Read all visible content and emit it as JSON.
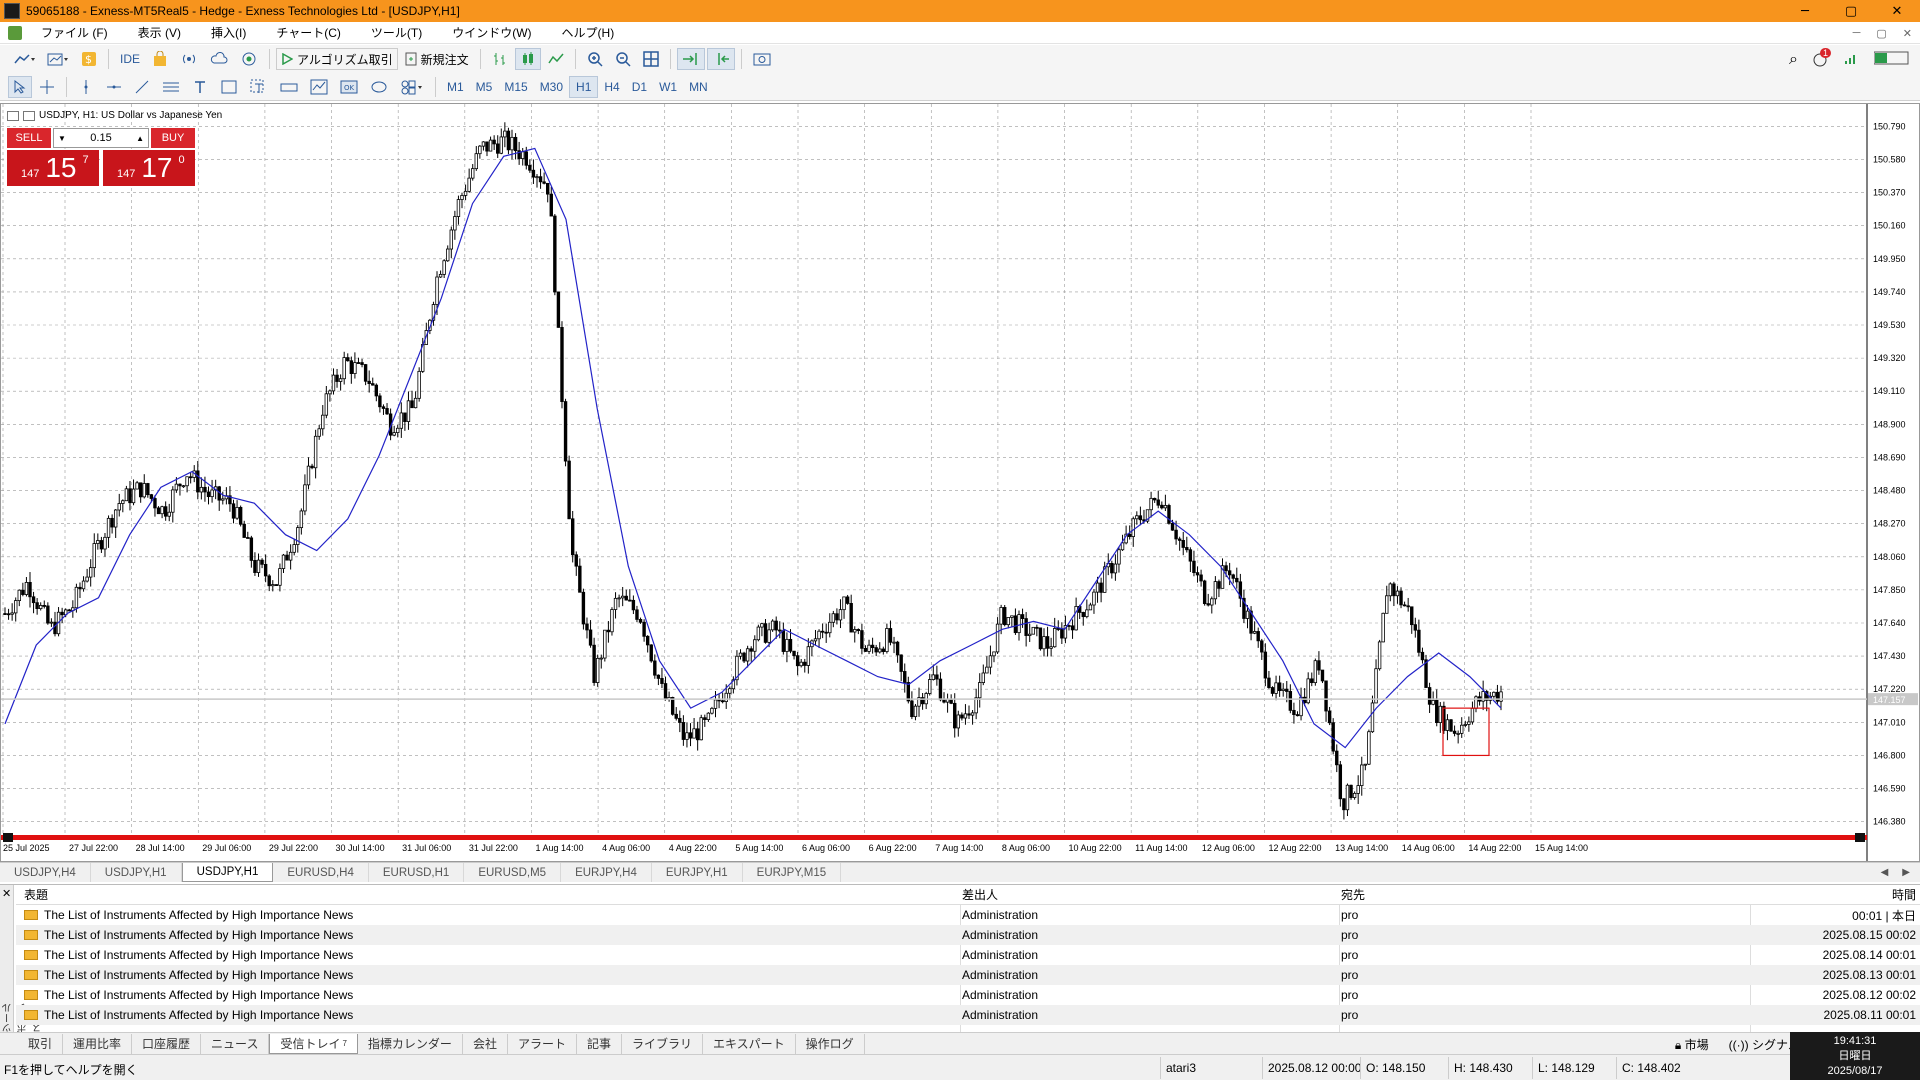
{
  "window": {
    "title": "59065188 - Exness-MT5Real5 - Hedge - Exness Technologies Ltd - [USDJPY,H1]",
    "min": "─",
    "max": "▢",
    "close": "✕"
  },
  "menu": [
    "ファイル (F)",
    "表示 (V)",
    "挿入(I)",
    "チャート(C)",
    "ツール(T)",
    "ウインドウ(W)",
    "ヘルプ(H)"
  ],
  "toolbar1": {
    "ide": "IDE",
    "algo": "アルゴリズム取引",
    "neworder": "新規注文",
    "notif_count": "1",
    "search": "⌕"
  },
  "timeframes": [
    "M1",
    "M5",
    "M15",
    "M30",
    "H1",
    "H4",
    "D1",
    "W1",
    "MN"
  ],
  "active_tf": "H1",
  "chart": {
    "header": "USDJPY, H1:  US Dollar vs Japanese Yen",
    "sell": "SELL",
    "buy": "BUY",
    "lot": "0.15",
    "sell_small": "147",
    "sell_big": "15",
    "sell_sup": "7",
    "buy_small": "147",
    "buy_big": "17",
    "buy_sup": "0",
    "current_price": "147.157"
  },
  "chart_data": {
    "type": "candlestick",
    "ylim": [
      146.27,
      150.9
    ],
    "y_ticks": [
      "150.790",
      "150.580",
      "150.370",
      "150.160",
      "149.950",
      "149.740",
      "149.530",
      "149.320",
      "149.110",
      "148.900",
      "148.690",
      "148.480",
      "148.270",
      "148.060",
      "147.850",
      "147.640",
      "147.430",
      "147.220",
      "147.010",
      "146.800",
      "146.590",
      "146.380"
    ],
    "x_ticks": [
      "25 Jul 2025",
      "27 Jul 22:00",
      "28 Jul 14:00",
      "29 Jul 06:00",
      "29 Jul 22:00",
      "30 Jul 14:00",
      "31 Jul 06:00",
      "31 Jul 22:00",
      "1 Aug 14:00",
      "4 Aug 06:00",
      "4 Aug 22:00",
      "5 Aug 14:00",
      "6 Aug 06:00",
      "6 Aug 22:00",
      "7 Aug 14:00",
      "8 Aug 06:00",
      "10 Aug 22:00",
      "11 Aug 14:00",
      "12 Aug 06:00",
      "12 Aug 22:00",
      "13 Aug 14:00",
      "14 Aug 06:00",
      "14 Aug 22:00",
      "15 Aug 14:00"
    ],
    "close_path": [
      147.7,
      147.9,
      147.6,
      147.75,
      148.1,
      148.4,
      148.5,
      148.35,
      148.6,
      148.45,
      148.4,
      148.0,
      147.9,
      148.3,
      149.0,
      149.3,
      149.2,
      148.9,
      149.0,
      149.8,
      150.3,
      150.65,
      150.7,
      150.6,
      150.4,
      148.1,
      147.3,
      147.8,
      147.7,
      147.2,
      146.9,
      147.0,
      147.3,
      147.55,
      147.6,
      147.35,
      147.6,
      147.75,
      147.45,
      147.55,
      147.1,
      147.3,
      147.0,
      147.2,
      147.7,
      147.6,
      147.5,
      147.65,
      147.8,
      148.05,
      148.3,
      148.45,
      148.1,
      147.8,
      148.0,
      147.6,
      147.2,
      147.1,
      147.4,
      146.5,
      146.7,
      147.9,
      147.7,
      147.1,
      146.95,
      147.15,
      147.2
    ],
    "ma_path": [
      147.0,
      147.5,
      147.7,
      147.8,
      148.2,
      148.5,
      148.6,
      148.45,
      148.4,
      148.2,
      148.1,
      148.3,
      148.7,
      149.2,
      149.7,
      150.3,
      150.6,
      150.65,
      150.2,
      149.0,
      148.0,
      147.4,
      147.1,
      147.2,
      147.4,
      147.6,
      147.5,
      147.4,
      147.3,
      147.25,
      147.4,
      147.5,
      147.6,
      147.65,
      147.6,
      147.9,
      148.2,
      148.35,
      148.2,
      148.0,
      147.7,
      147.4,
      147.0,
      146.85,
      147.1,
      147.3,
      147.45,
      147.3,
      147.1
    ]
  },
  "chart_tabs": [
    "USDJPY,H4",
    "USDJPY,H1",
    "USDJPY,H1",
    "EURUSD,H4",
    "EURUSD,H1",
    "EURUSD,M5",
    "EURJPY,H4",
    "EURJPY,H1",
    "EURJPY,M15"
  ],
  "active_chart_tab": 2,
  "toolbox": {
    "side_label": "ツールボックス",
    "columns": [
      "表題",
      "差出人",
      "宛先",
      "時間"
    ],
    "rows": [
      {
        "subject": "The List of Instruments Affected by High Importance News",
        "from": "Administration",
        "to": "pro",
        "time": "00:01 | 本日"
      },
      {
        "subject": "The List of Instruments Affected by High Importance News",
        "from": "Administration",
        "to": "pro",
        "time": "2025.08.15 00:02"
      },
      {
        "subject": "The List of Instruments Affected by High Importance News",
        "from": "Administration",
        "to": "pro",
        "time": "2025.08.14 00:01"
      },
      {
        "subject": "The List of Instruments Affected by High Importance News",
        "from": "Administration",
        "to": "pro",
        "time": "2025.08.13 00:01"
      },
      {
        "subject": "The List of Instruments Affected by High Importance News",
        "from": "Administration",
        "to": "pro",
        "time": "2025.08.12 00:02"
      },
      {
        "subject": "The List of Instruments Affected by High Importance News",
        "from": "Administration",
        "to": "pro",
        "time": "2025.08.11 00:01"
      }
    ]
  },
  "bottom_tabs": [
    "取引",
    "運用比率",
    "口座履歴",
    "ニュース",
    "受信トレイ",
    "指標カレンダー",
    "会社",
    "アラート",
    "記事",
    "ライブラリ",
    "エキスパート",
    "操作ログ"
  ],
  "active_bottom_tab": 4,
  "inbox_count": "7",
  "bottom_right": {
    "market": "市場",
    "signal": "シグナル"
  },
  "status": {
    "help": "F1を押してヘルプを開く",
    "profile": "atari3",
    "time": "2025.08.12 00:00",
    "open": "O: 148.150",
    "high": "H: 148.430",
    "low": "L: 148.129",
    "close": "C: 148.402"
  },
  "clock": {
    "time": "19:41:31",
    "day": "日曜日",
    "date": "2025/08/17"
  },
  "colors": {
    "title": "#f7941d",
    "candle": "#000000",
    "ma": "#2323c8",
    "sell": "#d9262c",
    "grid": "#9a9a9a",
    "redbar": "#e01010"
  }
}
